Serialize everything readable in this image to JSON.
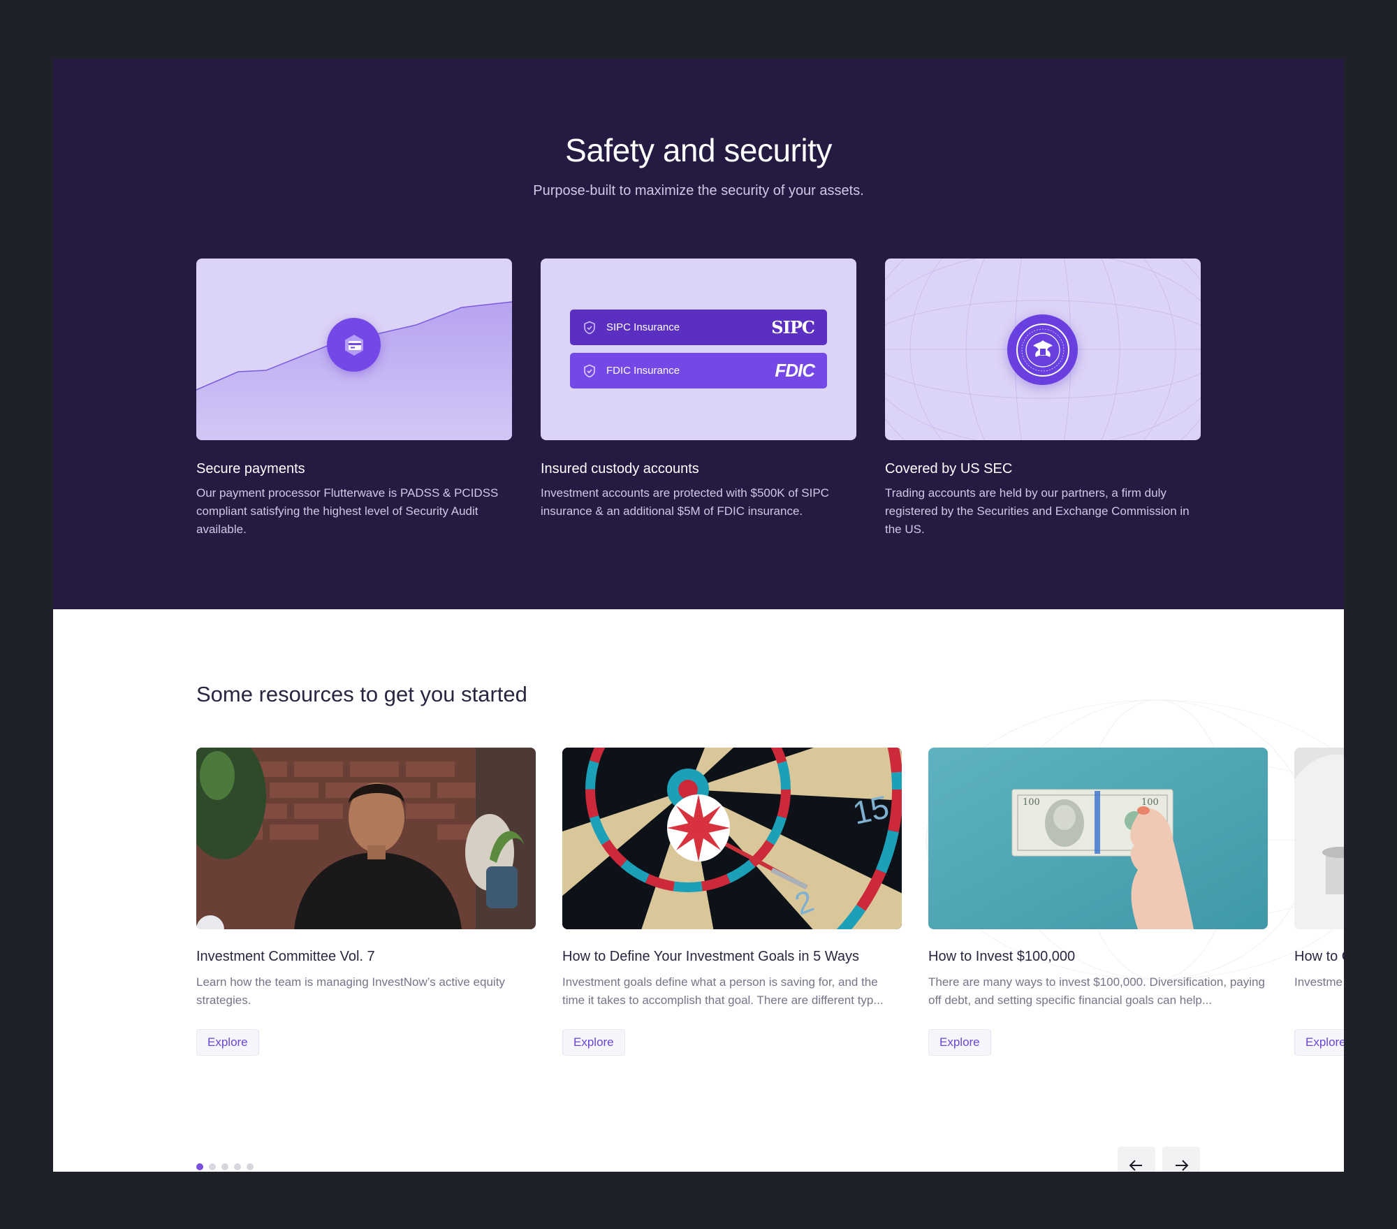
{
  "safety": {
    "title": "Safety and security",
    "subtitle": "Purpose-built to maximize the security of your assets.",
    "features": [
      {
        "title": "Secure payments",
        "description": "Our payment processor Flutterwave is PADSS & PCIDSS compliant satisfying the highest level of Security Audit available.",
        "icon": "credit-card-icon"
      },
      {
        "title": "Insured custody accounts",
        "description": "Investment accounts are protected with $500K of SIPC insurance & an additional $5M of FDIC insurance.",
        "insurance": [
          {
            "label": "SIPC Insurance",
            "logo": "SIPC",
            "color": "#5a2fc2"
          },
          {
            "label": "FDIC Insurance",
            "logo": "FDIC",
            "color": "#7448e6"
          }
        ]
      },
      {
        "title": "Covered by US SEC",
        "description": "Trading accounts are held by our partners, a firm duly registered by the Securities and Exchange Commission in the US.",
        "seal_text": "SECURITIES AND EXCHANGE COMMISSION · MCMXXXIV"
      }
    ]
  },
  "resources": {
    "title": "Some resources to get you started",
    "cards": [
      {
        "title": "Investment Committee Vol. 7",
        "description": "Learn how the team is managing InvestNow’s active equity strategies.",
        "cta": "Explore",
        "image": "video-thumbnail"
      },
      {
        "title": "How to Define Your Investment Goals in 5 Ways",
        "description": "Investment goals define what a person is saving for, and the time it takes to accomplish that goal. There are different typ...",
        "cta": "Explore",
        "image": "dartboard"
      },
      {
        "title": "How to Invest $100,000",
        "description": "There are many ways to invest $100,000. Diversification, paying off debt, and setting specific financial goals can help...",
        "cta": "Explore",
        "image": "hundred-dollar-bill"
      },
      {
        "title": "How to C",
        "description": "Investme time it tal",
        "cta": "Explore",
        "image": "glass-jar"
      }
    ],
    "pagination": {
      "total": 5,
      "active": 0
    },
    "prev_icon": "arrow-left-icon",
    "next_icon": "arrow-right-icon"
  },
  "colors": {
    "accent": "#7a4fe0",
    "dark_bg": "#241a42",
    "card_bg": "#dcd4f6"
  }
}
